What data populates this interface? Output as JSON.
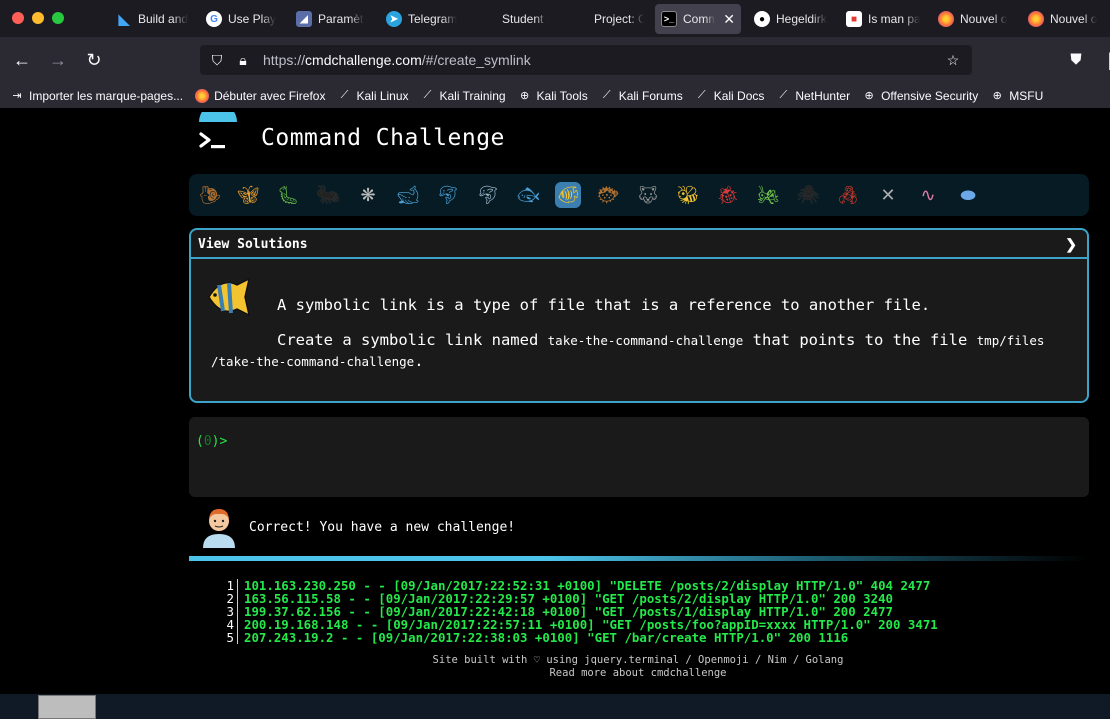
{
  "browser": {
    "tabs": [
      {
        "label": "Build and",
        "icon": "flutter-icon",
        "color": "#42a5f5"
      },
      {
        "label": "Use Play",
        "icon": "google-icon",
        "color": "#ffffff"
      },
      {
        "label": "Paramètr",
        "icon": "settings-page-icon",
        "color": "#5b6ea8"
      },
      {
        "label": "Telegram",
        "icon": "telegram-icon",
        "color": "#2aa3df"
      },
      {
        "label": "Student c",
        "icon": "",
        "color": ""
      },
      {
        "label": "Project: C",
        "icon": "",
        "color": ""
      },
      {
        "label": "Comm",
        "icon": "terminal-icon",
        "color": "#000000",
        "active": true
      },
      {
        "label": "Hegeldirk",
        "icon": "github-icon",
        "color": "#ffffff"
      },
      {
        "label": "Is man pa",
        "icon": "page-icon",
        "color": "#e53935"
      },
      {
        "label": "Nouvel o",
        "icon": "firefox-icon",
        "color": "#ff7139"
      },
      {
        "label": "Nouvel o",
        "icon": "firefox-icon",
        "color": "#ff7139"
      }
    ],
    "url": {
      "prefix": "https://",
      "host": "cmdchallenge.com",
      "path": "/#/create_symlink"
    },
    "bookmarks": [
      {
        "label": "Importer les marque-pages...",
        "icon": "import-icon"
      },
      {
        "label": "Débuter avec Firefox",
        "icon": "firefox-icon"
      },
      {
        "label": "Kali Linux",
        "icon": "kali-icon"
      },
      {
        "label": "Kali Training",
        "icon": "kali-icon"
      },
      {
        "label": "Kali Tools",
        "icon": "globe-icon"
      },
      {
        "label": "Kali Forums",
        "icon": "kali-icon"
      },
      {
        "label": "Kali Docs",
        "icon": "kali-icon"
      },
      {
        "label": "NetHunter",
        "icon": "kali-icon"
      },
      {
        "label": "Offensive Security",
        "icon": "globe-icon"
      },
      {
        "label": "MSFU",
        "icon": "globe-icon"
      }
    ]
  },
  "site": {
    "title": "Command Challenge",
    "critters": [
      "snail",
      "butterfly",
      "caterpillar",
      "ant",
      "spider-web",
      "whale",
      "dolphin",
      "dolphin-2",
      "fish",
      "tropical-fish",
      "blowfish",
      "wolf",
      "bee",
      "ladybug",
      "cricket",
      "spider",
      "scorpion",
      "fly",
      "worm",
      "microbe"
    ],
    "challenge": {
      "view_solutions": "View Solutions",
      "intro": "A symbolic link is a type of file that is a reference to another file.",
      "task_prefix": "Create a symbolic link named",
      "link_name": "take-the-command-challenge",
      "task_middle": "that points to the file",
      "target_a": "tmp/files",
      "target_b": "/take-the-command-challenge",
      "task_suffix": "."
    },
    "terminal": {
      "prompt_open": "(",
      "exit_code": "0",
      "prompt_close": ")>"
    },
    "feedback": "Correct! You have a new challenge!",
    "log_lines": [
      {
        "n": "1",
        "text": "101.163.230.250 - - [09/Jan/2017:22:52:31 +0100] \"DELETE /posts/2/display HTTP/1.0\" 404 2477"
      },
      {
        "n": "2",
        "text": "163.56.115.58 - - [09/Jan/2017:22:29:57 +0100] \"GET /posts/2/display HTTP/1.0\" 200 3240"
      },
      {
        "n": "3",
        "text": "199.37.62.156 - - [09/Jan/2017:22:42:18 +0100] \"GET /posts/1/display HTTP/1.0\" 200 2477"
      },
      {
        "n": "4",
        "text": "200.19.168.148 - - [09/Jan/2017:22:57:11 +0100] \"GET /posts/foo?appID=xxxx HTTP/1.0\" 200 3471"
      },
      {
        "n": "5",
        "text": "207.243.19.2 - - [09/Jan/2017:22:38:03 +0100] \"GET /bar/create HTTP/1.0\" 200 1116"
      }
    ],
    "footer_line1": "Site built with ♡ using jquery.terminal / Openmoji / Nim / Golang",
    "footer_line2": "Read more about cmdchallenge"
  }
}
